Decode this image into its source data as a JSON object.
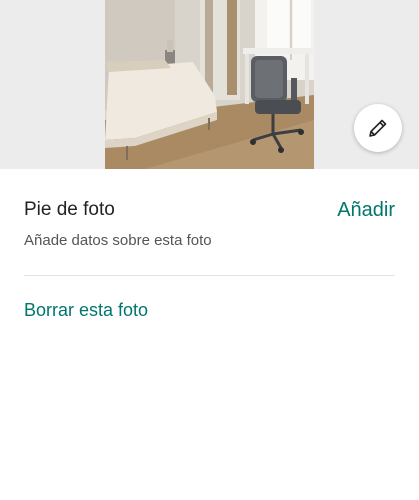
{
  "photo": {
    "alt": "Dormitorio con cama, escritorio y silla de oficina"
  },
  "edit_button": {
    "icon": "pencil-icon"
  },
  "caption": {
    "title": "Pie de foto",
    "add_label": "Añadir",
    "hint": "Añade datos sobre esta foto"
  },
  "delete_label": "Borrar esta foto",
  "colors": {
    "accent": "#00766e",
    "text_primary": "#222222",
    "text_secondary": "#555555",
    "photo_backdrop": "#ececec"
  }
}
